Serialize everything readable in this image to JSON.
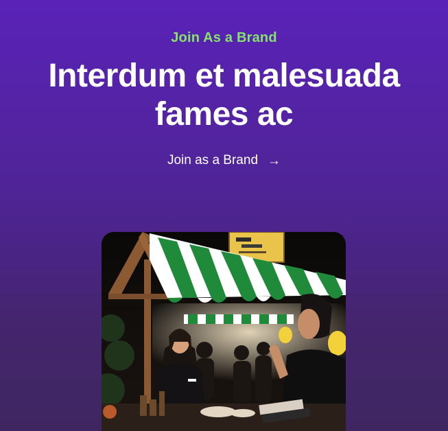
{
  "hero": {
    "eyebrow": "Join As a Brand",
    "headline": "Interdum et malesuada fames ac",
    "cta_label": "Join as a Brand",
    "cta_icon": "arrow-right-icon"
  },
  "colors": {
    "background_top": "#5a22b8",
    "background_bottom": "#3f2660",
    "eyebrow": "#86e36a",
    "text": "#ffffff"
  },
  "image": {
    "subject": "night market stall with green-and-white striped awning"
  }
}
